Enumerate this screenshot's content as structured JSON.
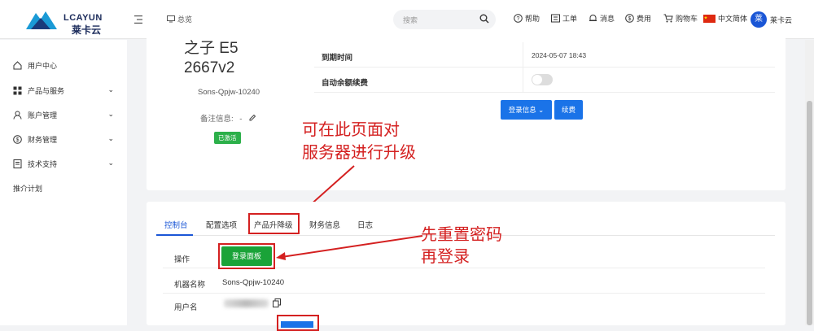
{
  "brand": {
    "logo_en": "LCAYUN",
    "logo_cn": "莱卡云"
  },
  "header": {
    "overview": "总览",
    "search_placeholder": "搜索",
    "help": "帮助",
    "ticket": "工单",
    "messages": "消息",
    "fees": "费用",
    "cart": "购物车",
    "language": "中文简体",
    "avatar_char": "莱",
    "user": "莱卡云"
  },
  "sidebar": {
    "items": [
      {
        "label": "用户中心",
        "icon": "home-icon"
      },
      {
        "label": "产品与服务",
        "icon": "grid-icon",
        "chevron": "⌄"
      },
      {
        "label": "账户管理",
        "icon": "user-icon",
        "chevron": "⌄"
      },
      {
        "label": "财务管理",
        "icon": "dollar-icon",
        "chevron": "⌄"
      },
      {
        "label": "技术支持",
        "icon": "doc-icon",
        "chevron": "⌄"
      },
      {
        "label": "推介计划"
      }
    ]
  },
  "product": {
    "name_line1": "之子 E5",
    "name_line2": "2667v2",
    "hostname": "Sons-Qpjw-10240",
    "remark_label": "备注信息:",
    "remark_value": "-",
    "status": "已激活"
  },
  "info_rows": [
    {
      "label": "到期时间",
      "value": "2024-05-07 18:43"
    },
    {
      "label": "自动余额续费",
      "value": ""
    }
  ],
  "buttons": {
    "login_info": "登录信息 ⌄",
    "renew": "续费"
  },
  "annotations": {
    "upgrade_line1": "可在此页面对",
    "upgrade_line2": "服务器进行升级",
    "reset_line1": "先重置密码",
    "reset_line2": "再登录"
  },
  "tabs": [
    {
      "label": "控制台",
      "active": true
    },
    {
      "label": "配置选项"
    },
    {
      "label": "产品升降级"
    },
    {
      "label": "财务信息"
    },
    {
      "label": "日志"
    }
  ],
  "details": {
    "operation_label": "操作",
    "login_panel_button": "登录面板",
    "machine_name_label": "机器名称",
    "machine_name_value": "Sons-Qpjw-10240",
    "username_label": "用户名"
  },
  "colors": {
    "accent": "#1a56d6",
    "primary_button": "#1a73e8",
    "success": "#1aa338",
    "annotation": "#d42020"
  }
}
